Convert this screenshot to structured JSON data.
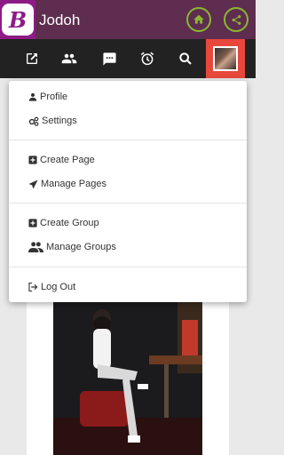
{
  "app": {
    "logo_letter": "B",
    "title": "Jodoh"
  },
  "header": {
    "home_icon": "home-icon",
    "share_icon": "share-icon",
    "accent": "#8ab82f"
  },
  "nav": {
    "items": [
      {
        "icon": "compose-icon"
      },
      {
        "icon": "friends-icon"
      },
      {
        "icon": "messages-icon"
      },
      {
        "icon": "alarm-icon"
      },
      {
        "icon": "search-icon"
      }
    ],
    "active_color": "#e8473c"
  },
  "menu": {
    "profile": "Profile",
    "settings": "Settings",
    "create_page": "Create Page",
    "manage_pages": "Manage Pages",
    "create_group": "Create Group",
    "manage_groups": "Manage Groups",
    "logout": "Log Out"
  },
  "colors": {
    "header_bg": "#5e2d4f",
    "logo_bg": "#8d1b86",
    "nav_bg": "#222222"
  }
}
